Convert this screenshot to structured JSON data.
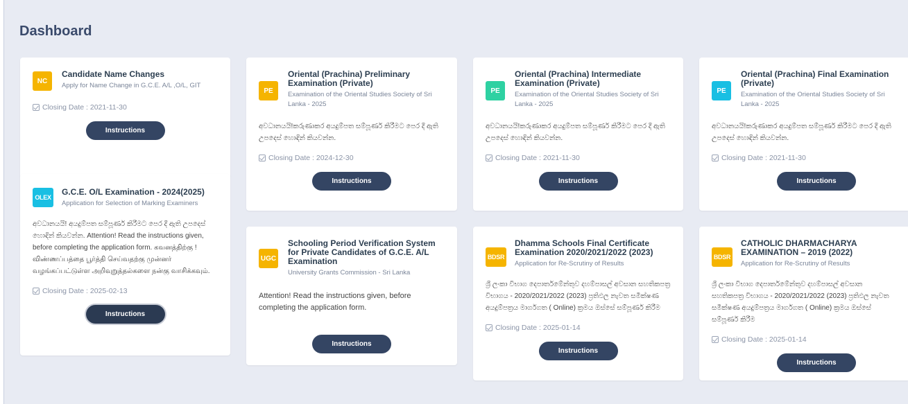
{
  "page": {
    "title": "Dashboard"
  },
  "colors": {
    "yellow": "#f5b400",
    "green": "#2ed1a2",
    "cyan": "#19bfe3",
    "button": "#344563"
  },
  "cards": [
    {
      "badge": "NC",
      "badge_color": "yellow",
      "title": "Candidate Name Changes",
      "subtitle": "Apply for Name Change in G.C.E. A/L ,O/L, GIT",
      "description": "",
      "closing": "Closing Date : 2021-11-30",
      "button": "Instructions"
    },
    {
      "badge": "PE",
      "badge_color": "yellow",
      "title": "Oriental (Prachina) Preliminary Examination (Private)",
      "subtitle": "Examination of the Oriental Studies Society of Sri Lanka - 2025",
      "description": "අවධානයයි!කරුණාකර අයදුම්පත සම්පූර්ණ කිරීමට පෙර දී ඇති උපදෙස් හොඳින් කියවන්න.",
      "closing": "Closing Date : 2024-12-30",
      "button": "Instructions"
    },
    {
      "badge": "PE",
      "badge_color": "green",
      "title": "Oriental (Prachina) Intermediate Examination (Private)",
      "subtitle": "Examination of the Oriental Studies Society of Sri Lanka - 2025",
      "description": "අවධානයයි!කරුණාකර අයදුම්පත සම්පූර්ණ කිරීමට පෙර දී ඇති උපදෙස් හොඳින් කියවන්න.",
      "closing": "Closing Date : 2021-11-30",
      "button": "Instructions"
    },
    {
      "badge": "PE",
      "badge_color": "cyan",
      "title": "Oriental (Prachina) Final Examination (Private)",
      "subtitle": "Examination of the Oriental Studies Society of Sri Lanka - 2025",
      "description": "අවධානයයි!කරුණාකර අයදුම්පත සම්පූර්ණ කිරීමට පෙර දී ඇති උපදෙස් හොඳින් කියවන්න.",
      "closing": "Closing Date : 2021-11-30",
      "button": "Instructions"
    },
    {
      "badge": "OLEX",
      "badge_color": "cyan",
      "title": "G.C.E. O/L Examination - 2024(2025)",
      "subtitle": "Application for Selection of Marking Examiners",
      "description": "අවධානයයි! අයදුම්පත සම්පූර්ණ කිරීමට පෙර දී ඇති උපදෙස් හොඳින් කියවන්න. Attention! Read the instructions given, before completing the application form. கவனத்திற்கு ! விண்ணப்பத்தை பூர்த்தி செய்வதற்கு முன்னர் வழங்கப்பட்டுள்ள அறிவுறுத்தல்களை நன்கு வாசிக்கவும்.",
      "closing": "Closing Date : 2025-02-13",
      "button": "Instructions"
    },
    {
      "badge": "UGC",
      "badge_color": "yellow",
      "title": "Schooling Period Verification System for Private Candidates of G.C.E. A/L Examination",
      "subtitle": "University Grants Commission - Sri Lanka",
      "description": "Attention! Read the instructions given, before completing the application form.",
      "closing": "",
      "button": "Instructions"
    },
    {
      "badge": "BDSR",
      "badge_color": "yellow",
      "title": "Dhamma Schools Final Certificate Examination 2020/2021/2022 (2023)",
      "subtitle": "Application for Re-Scrutiny of Results",
      "description": "ශ්‍රී ලංකා විභාග දෙපාර්තමේන්තුව දහම්පාසල් අවසාන සහතිකපත්‍ර විභාගය - 2020/2021/2022 (2023) ප්‍රතිඵල නැවත සමීක්ෂණ අයදුම්පත්‍රය මාර්ගගත ( Online) ක්‍රමය ඔස්සේ සම්පූර්ණ කිරීම",
      "closing": "Closing Date : 2025-01-14",
      "button": "Instructions"
    },
    {
      "badge": "BDSR",
      "badge_color": "yellow",
      "title": "CATHOLIC DHARMACHARYA EXAMINATION – 2019 (2022)",
      "subtitle": "Application for Re-Scrutiny of Results",
      "description": "ශ්‍රී ලංකා විභාග දෙපාර්තමේන්තුව දහම්පාසල් අවසාන සහතිකපත්‍ර විභාගය - 2020/2021/2022 (2023) ප්‍රතිඵල නැවත සමීක්ෂණ අයදුම්පත්‍රය මාර්ගගත ( Online) ක්‍රමය ඔස්සේ සම්පූර්ණ කිරීම",
      "closing": "Closing Date : 2025-01-14",
      "button": "Instructions"
    }
  ]
}
